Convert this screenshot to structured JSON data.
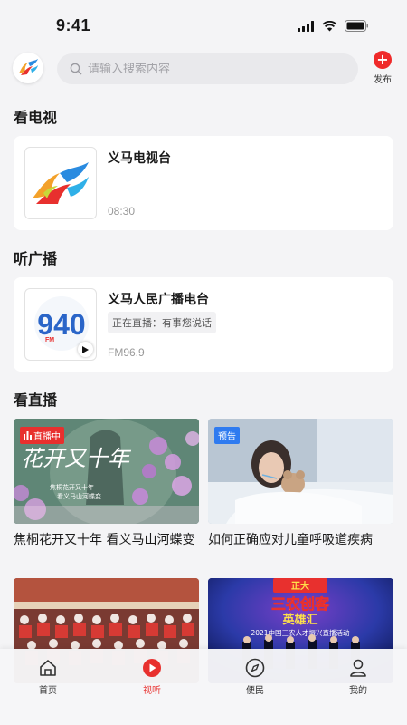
{
  "status_bar": {
    "time": "9:41"
  },
  "header": {
    "search_placeholder": "请输入搜索内容",
    "publish_label": "发布"
  },
  "tv_section": {
    "title": "看电视",
    "card": {
      "name": "义马电视台",
      "time": "08:30"
    }
  },
  "radio_section": {
    "title": "听广播",
    "card": {
      "name": "义马人民广播电台",
      "live_text": "正在直播：有事您说话",
      "frequency": "FM96.9",
      "logo_text": "940",
      "logo_sub": "FM"
    }
  },
  "live_section": {
    "title": "看直播",
    "videos": [
      {
        "badge": "直播中",
        "title": "焦桐花开又十年 看义马山河蝶变",
        "overlay_title": "花开又十年",
        "overlay_sub1": "焦桐花开又十年",
        "overlay_sub2": "看义马山河蝶变"
      },
      {
        "badge": "预告",
        "title": "如何正确应对儿童呼吸道疾病"
      },
      {
        "title": ""
      },
      {
        "title": "",
        "overlay_line1": "正大",
        "overlay_line2": "三农创客",
        "overlay_line3": "英雄汇",
        "overlay_line4": "2021中国三农人才振兴直播活动"
      }
    ]
  },
  "tabbar": {
    "tabs": [
      {
        "label": "首页"
      },
      {
        "label": "视听"
      },
      {
        "label": "便民"
      },
      {
        "label": "我的"
      }
    ]
  },
  "colors": {
    "accent": "#e8302e",
    "preview_badge": "#2f7bf0"
  }
}
